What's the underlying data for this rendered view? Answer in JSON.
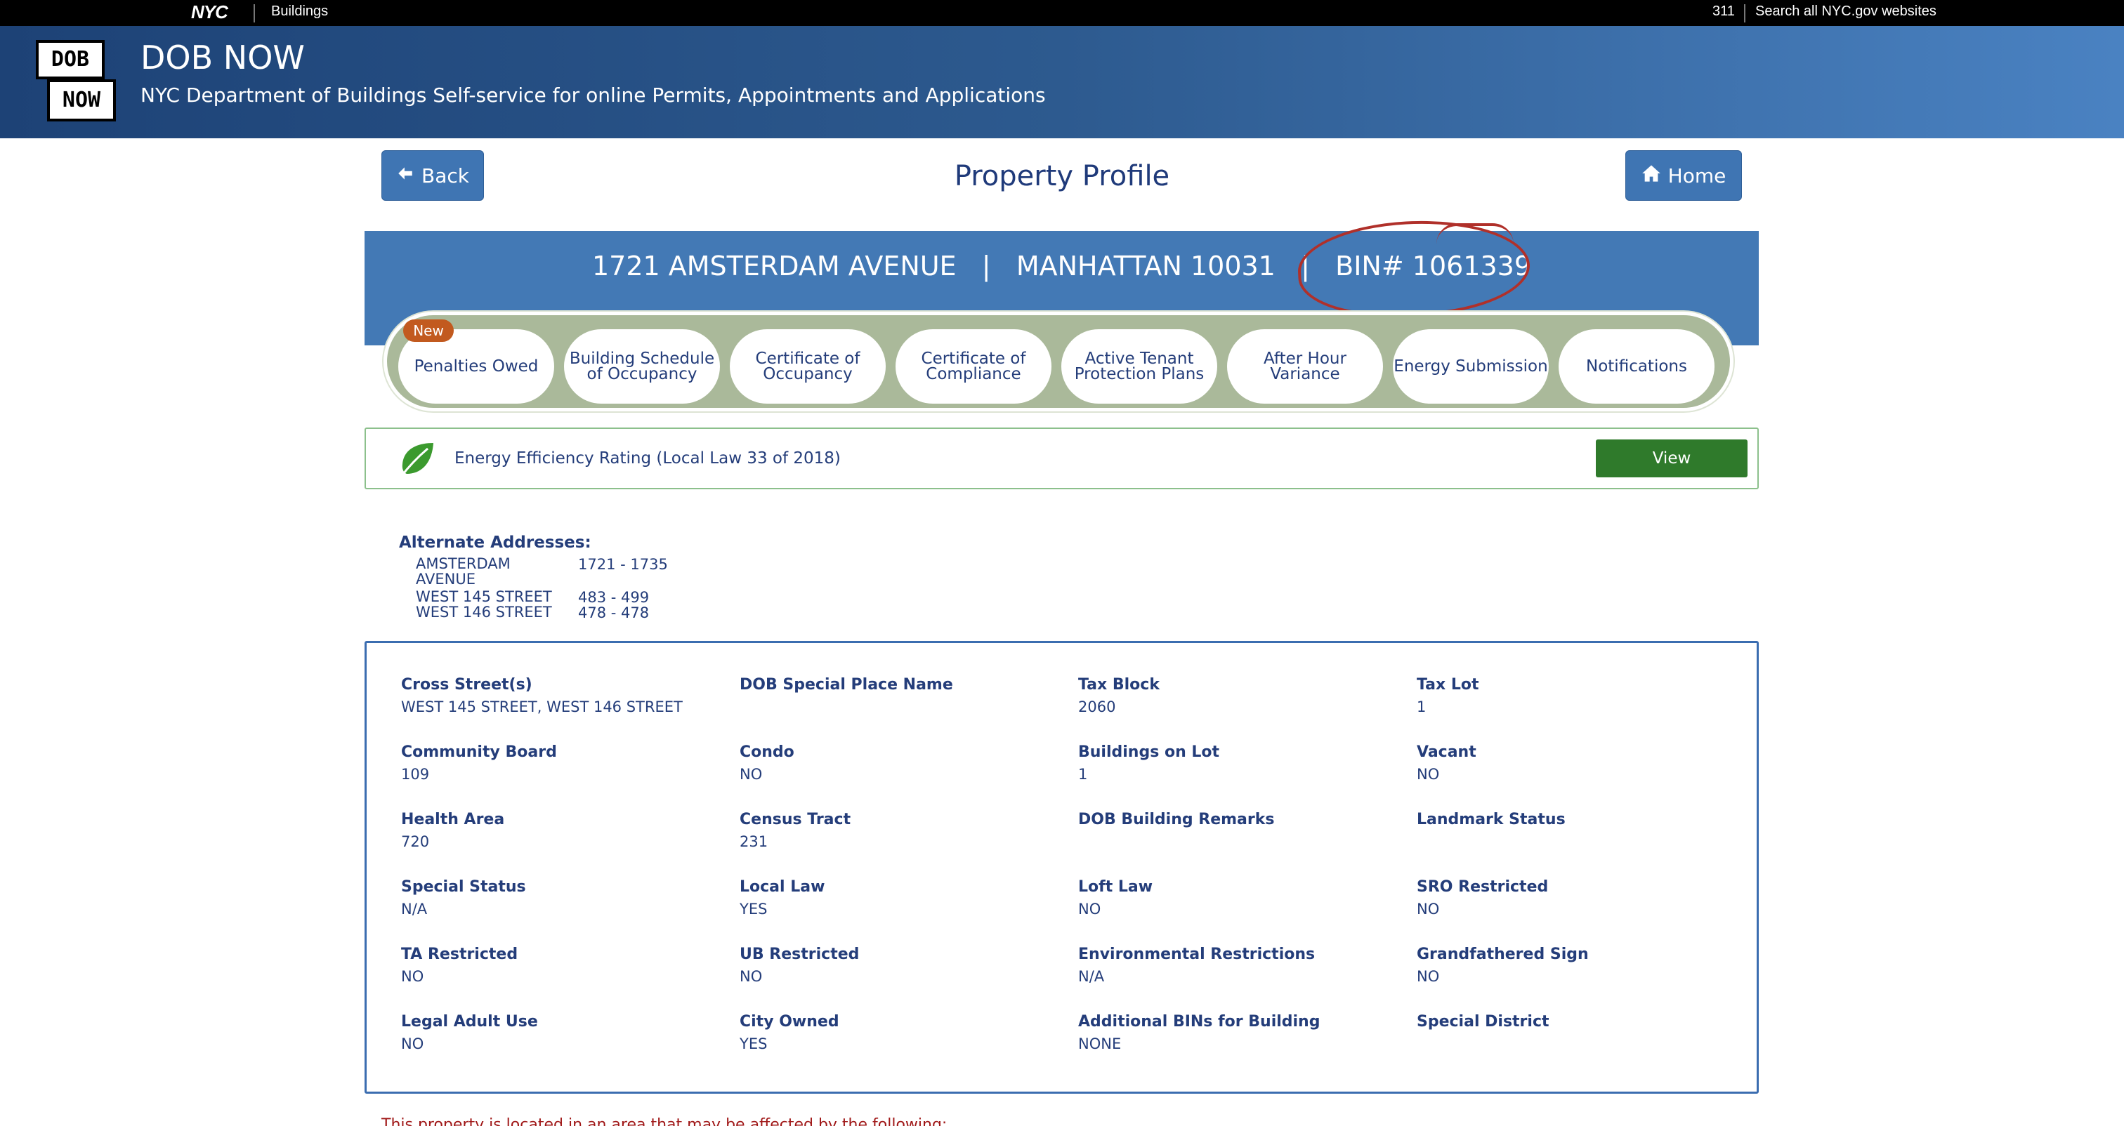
{
  "nyc_bar": {
    "logo": "NYC",
    "agency": "Buildings",
    "link_311": "311",
    "search": "Search all NYC.gov websites"
  },
  "header": {
    "logo_top": "DOB",
    "logo_bottom": "NOW",
    "title": "DOB NOW",
    "subtitle": "NYC Department of Buildings Self-service for online Permits, Appointments and Applications"
  },
  "nav": {
    "back_label": "Back",
    "home_label": "Home",
    "page_title": "Property Profile"
  },
  "address": {
    "line": "1721 AMSTERDAM AVENUE   |   MANHATTAN 10031   |   BIN# 1061339"
  },
  "tabs": {
    "new_badge": "New",
    "items": [
      {
        "label": "Penalties Owed"
      },
      {
        "label": "Building Schedule of Occupancy"
      },
      {
        "label": "Certificate of Occupancy"
      },
      {
        "label": "Certificate of Compliance"
      },
      {
        "label": "Active Tenant Protection Plans"
      },
      {
        "label": "After Hour Variance"
      },
      {
        "label": "Energy Submission"
      },
      {
        "label": "Notifications"
      }
    ]
  },
  "energy": {
    "text": "Energy Efficiency Rating (Local Law 33 of 2018)",
    "view_label": "View",
    "icon": "leaf-icon"
  },
  "alternate_addresses": {
    "title": "Alternate Addresses:",
    "rows": [
      {
        "street": "AMSTERDAM AVENUE",
        "range": "1721 - 1735"
      },
      {
        "street": "WEST 145 STREET",
        "range": "483 - 499"
      },
      {
        "street": "WEST 146 STREET",
        "range": "478 - 478"
      }
    ]
  },
  "details": {
    "fields": [
      {
        "label": "Cross Street(s)",
        "value": "WEST 145 STREET, WEST 146 STREET"
      },
      {
        "label": "DOB Special Place Name",
        "value": ""
      },
      {
        "label": "Tax Block",
        "value": "2060"
      },
      {
        "label": "Tax Lot",
        "value": "1"
      },
      {
        "label": "Community Board",
        "value": "109"
      },
      {
        "label": "Condo",
        "value": "NO"
      },
      {
        "label": "Buildings on Lot",
        "value": "1"
      },
      {
        "label": "Vacant",
        "value": "NO"
      },
      {
        "label": "Health Area",
        "value": "720"
      },
      {
        "label": "Census Tract",
        "value": "231"
      },
      {
        "label": "DOB Building Remarks",
        "value": ""
      },
      {
        "label": "Landmark Status",
        "value": ""
      },
      {
        "label": "Special Status",
        "value": "N/A"
      },
      {
        "label": "Local Law",
        "value": "YES"
      },
      {
        "label": "Loft Law",
        "value": "NO"
      },
      {
        "label": "SRO Restricted",
        "value": "NO"
      },
      {
        "label": "TA Restricted",
        "value": "NO"
      },
      {
        "label": "UB Restricted",
        "value": "NO"
      },
      {
        "label": "Environmental Restrictions",
        "value": "N/A"
      },
      {
        "label": "Grandfathered Sign",
        "value": "NO"
      },
      {
        "label": "Legal Adult Use",
        "value": "NO"
      },
      {
        "label": "City Owned",
        "value": "YES"
      },
      {
        "label": "Additional BINs for Building",
        "value": "NONE"
      },
      {
        "label": "Special District",
        "value": ""
      }
    ]
  },
  "footer_note": "This property is located in an area that may be affected by the following:"
}
